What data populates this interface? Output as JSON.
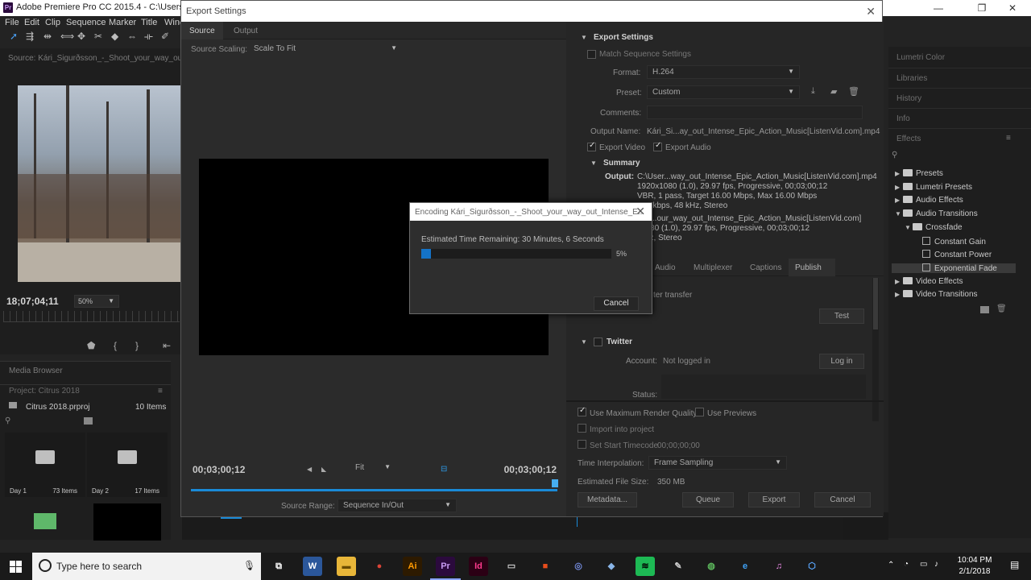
{
  "app": {
    "title": "Adobe Premiere Pro CC 2015.4 - C:\\Users\\j_art\\"
  },
  "menu": [
    "File",
    "Edit",
    "Clip",
    "Sequence",
    "Marker",
    "Title",
    "Wind"
  ],
  "source": {
    "header": "Source: Kári_Sigurðsson_-_Shoot_your_way_out_I",
    "timecode": "18;07;04;11",
    "zoom": "50%"
  },
  "project": {
    "tab": "Media Browser",
    "name_tab": "Project: Citrus 2018",
    "file": "Citrus 2018.prproj",
    "count": "10 Items",
    "bins": [
      {
        "name": "Day 1",
        "count": "73 Items"
      },
      {
        "name": "Day 2",
        "count": "17 Items"
      }
    ]
  },
  "right_panels": [
    "Lumetri Color",
    "Libraries",
    "History",
    "Info",
    "Effects"
  ],
  "effects_tree": [
    {
      "label": "Presets",
      "level": 0,
      "kind": "folder",
      "open": false
    },
    {
      "label": "Lumetri Presets",
      "level": 0,
      "kind": "folder",
      "open": false
    },
    {
      "label": "Audio Effects",
      "level": 0,
      "kind": "folder",
      "open": false
    },
    {
      "label": "Audio Transitions",
      "level": 0,
      "kind": "folder",
      "open": true
    },
    {
      "label": "Crossfade",
      "level": 1,
      "kind": "folder",
      "open": true
    },
    {
      "label": "Constant Gain",
      "level": 2,
      "kind": "effect"
    },
    {
      "label": "Constant Power",
      "level": 2,
      "kind": "effect"
    },
    {
      "label": "Exponential Fade",
      "level": 2,
      "kind": "effect",
      "selected": true
    },
    {
      "label": "Video Effects",
      "level": 0,
      "kind": "folder",
      "open": false
    },
    {
      "label": "Video Transitions",
      "level": 0,
      "kind": "folder",
      "open": false
    }
  ],
  "export": {
    "title": "Export Settings",
    "tabs": [
      "Source",
      "Output"
    ],
    "source_scaling_label": "Source Scaling:",
    "source_scaling_value": "Scale To Fit",
    "tc_in": "00;03;00;12",
    "tc_out": "00;03;00;12",
    "fit": "Fit",
    "source_range_label": "Source Range:",
    "source_range_value": "Sequence In/Out",
    "settings": {
      "header": "Export Settings",
      "match_seq": "Match Sequence Settings",
      "format_label": "Format:",
      "format_value": "H.264",
      "preset_label": "Preset:",
      "preset_value": "Custom",
      "comments_label": "Comments:",
      "output_name_label": "Output Name:",
      "output_name_value": "Kári_Si...ay_out_Intense_Epic_Action_Music[ListenVid.com].mp4",
      "export_video": "Export Video",
      "export_audio": "Export Audio"
    },
    "summary": {
      "header": "Summary",
      "output_label": "Output:",
      "output_lines": [
        "C:\\User...way_out_Intense_Epic_Action_Music[ListenVid.com].mp4",
        "1920x1080 (1.0), 29.97 fps, Progressive, 00;03;00;12",
        "VBR, 1 pass, Target 16.00 Mbps, Max 16.00 Mbps",
        "320 kbps, 48 kHz, Stereo"
      ],
      "source_lines": [
        "enc...our_way_out_Intense_Epic_Action_Music[ListenVid.com]",
        "x1080 (1.0), 29.97 fps, Progressive, 00;03;00;12",
        "0 Hz, Stereo"
      ]
    },
    "lower_tabs": [
      "Audio",
      "Multiplexer",
      "Captions",
      "Publish"
    ],
    "publish_partial": "ter transfer",
    "test_button": "Test",
    "twitter_header": "Twitter",
    "account_label": "Account:",
    "account_value": "Not logged in",
    "login_button": "Log in",
    "status_label": "Status:",
    "max_render": "Use Maximum Render Quality",
    "use_previews": "Use Previews",
    "import_project": "Import into project",
    "set_start_tc": "Set Start Timecode",
    "start_tc_value": "00;00;00;00",
    "interp_label": "Time Interpolation:",
    "interp_value": "Frame Sampling",
    "file_size_label": "Estimated File Size:",
    "file_size_value": "350 MB",
    "buttons": {
      "metadata": "Metadata...",
      "queue": "Queue",
      "export": "Export",
      "cancel": "Cancel"
    }
  },
  "encoding": {
    "title": "Encoding Kári_Sigurðsson_-_Shoot_your_way_out_Intense_E...",
    "eta": "Estimated Time Remaining: 30 Minutes, 6 Seconds",
    "progress": 0.05,
    "progress_text": "5%",
    "cancel": "Cancel"
  },
  "taskbar": {
    "search_placeholder": "Type here to search",
    "time": "10:04 PM",
    "date": "2/1/2018",
    "apps": [
      {
        "name": "task-view",
        "glyph": "⧉",
        "bg": "#1a1a1a",
        "fg": "#fff"
      },
      {
        "name": "word",
        "glyph": "W",
        "bg": "#2b579a",
        "fg": "#fff"
      },
      {
        "name": "file-explorer",
        "glyph": "▬",
        "bg": "#e8b639",
        "fg": "#6a4b00"
      },
      {
        "name": "chrome",
        "glyph": "●",
        "bg": "#1a1a1a",
        "fg": "#db4437"
      },
      {
        "name": "illustrator",
        "glyph": "Ai",
        "bg": "#2d1a00",
        "fg": "#ff9a00"
      },
      {
        "name": "premiere",
        "glyph": "Pr",
        "bg": "#2b0a3d",
        "fg": "#c79bf2",
        "active": true
      },
      {
        "name": "indesign",
        "glyph": "Id",
        "bg": "#2b0014",
        "fg": "#ff3b8d"
      },
      {
        "name": "photos",
        "glyph": "▭",
        "bg": "#1a1a1a",
        "fg": "#ccc"
      },
      {
        "name": "office",
        "glyph": "■",
        "bg": "#1a1a1a",
        "fg": "#e84d1c"
      },
      {
        "name": "discord",
        "glyph": "◎",
        "bg": "#1a1a1a",
        "fg": "#7289da"
      },
      {
        "name": "3d-box",
        "glyph": "◆",
        "bg": "#1a1a1a",
        "fg": "#8ab6e8"
      },
      {
        "name": "spotify",
        "glyph": "≋",
        "bg": "#1db954",
        "fg": "#000"
      },
      {
        "name": "tool",
        "glyph": "✎",
        "bg": "#1a1a1a",
        "fg": "#ccc"
      },
      {
        "name": "globe",
        "glyph": "◍",
        "bg": "#1a1a1a",
        "fg": "#5cb85c"
      },
      {
        "name": "edge",
        "glyph": "e",
        "bg": "#1a1a1a",
        "fg": "#3fa2f7"
      },
      {
        "name": "itunes",
        "glyph": "♫",
        "bg": "#1a1a1a",
        "fg": "#f58ff0"
      },
      {
        "name": "cube",
        "glyph": "⬡",
        "bg": "#1a1a1a",
        "fg": "#5aa7ff"
      }
    ]
  },
  "colors": {
    "accent": "#1473c8",
    "dialog_bg": "#2b2b2b",
    "panel_bg": "#1e1e1e"
  }
}
